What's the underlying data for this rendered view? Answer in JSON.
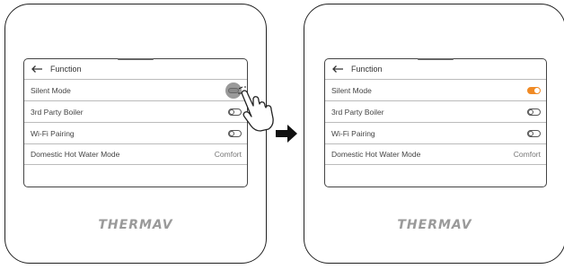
{
  "panels": [
    {
      "state": "before",
      "title": "Function",
      "items": [
        {
          "label": "Silent Mode",
          "control": "toggle",
          "toggle_state": "pressed"
        },
        {
          "label": "3rd Party Boiler",
          "control": "toggle",
          "toggle_state": "off"
        },
        {
          "label": "Wi-Fi Pairing",
          "control": "toggle",
          "toggle_state": "off"
        },
        {
          "label": "Domestic Hot Water Mode",
          "control": "value",
          "value": "Comfort"
        }
      ],
      "brand": "THERMAV"
    },
    {
      "state": "after",
      "title": "Function",
      "items": [
        {
          "label": "Silent Mode",
          "control": "toggle",
          "toggle_state": "on"
        },
        {
          "label": "3rd Party Boiler",
          "control": "toggle",
          "toggle_state": "off"
        },
        {
          "label": "Wi-Fi Pairing",
          "control": "toggle",
          "toggle_state": "off"
        },
        {
          "label": "Domestic Hot Water Mode",
          "control": "value",
          "value": "Comfort"
        }
      ],
      "brand": "THERMAV"
    }
  ],
  "colors": {
    "toggle_on": "#f08a24",
    "toggle_pressed": "#9a9a9a",
    "brand_text": "#9a9a9a"
  },
  "icons": [
    "back-arrow-icon",
    "hand-pointer-icon",
    "right-arrow-icon"
  ]
}
